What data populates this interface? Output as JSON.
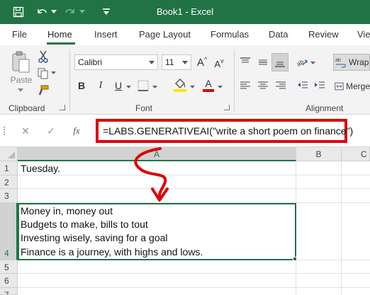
{
  "window": {
    "title": "Book1 - Excel"
  },
  "ribbon_tabs": [
    "File",
    "Home",
    "Insert",
    "Page Layout",
    "Formulas",
    "Data",
    "Review",
    "View"
  ],
  "ribbon": {
    "paste_label": "Paste",
    "font_name": "Calibri",
    "font_size": "11",
    "bold_label": "B",
    "italic_label": "I",
    "underline_label": "U",
    "font_color": "A",
    "grow_font": "A",
    "shrink_font": "A",
    "wrap_label": "Wrap",
    "merge_label": "Merge",
    "groups": {
      "clipboard": "Clipboard",
      "font": "Font",
      "alignment": "Alignment"
    }
  },
  "formula_bar": {
    "cancel_label": "✕",
    "enter_label": "✓",
    "fx_label": "fx",
    "formula": "=LABS.GENERATIVEAI(\"write a short poem on finance\")"
  },
  "grid": {
    "columns": [
      "A",
      "B",
      "C"
    ],
    "rows": [
      "1",
      "2",
      "3",
      "4",
      "5",
      "6",
      "7"
    ],
    "cells": {
      "A1": "Tuesday.",
      "A4": [
        "Money in, money out",
        "Budgets to make, bills to tout",
        "Investing wisely, saving for a goal",
        "Finance is a journey, with highs and lows."
      ]
    }
  },
  "colors": {
    "excel_green": "#217346",
    "highlight_red": "#e00000",
    "highlight_yellow": "#ffe600"
  }
}
